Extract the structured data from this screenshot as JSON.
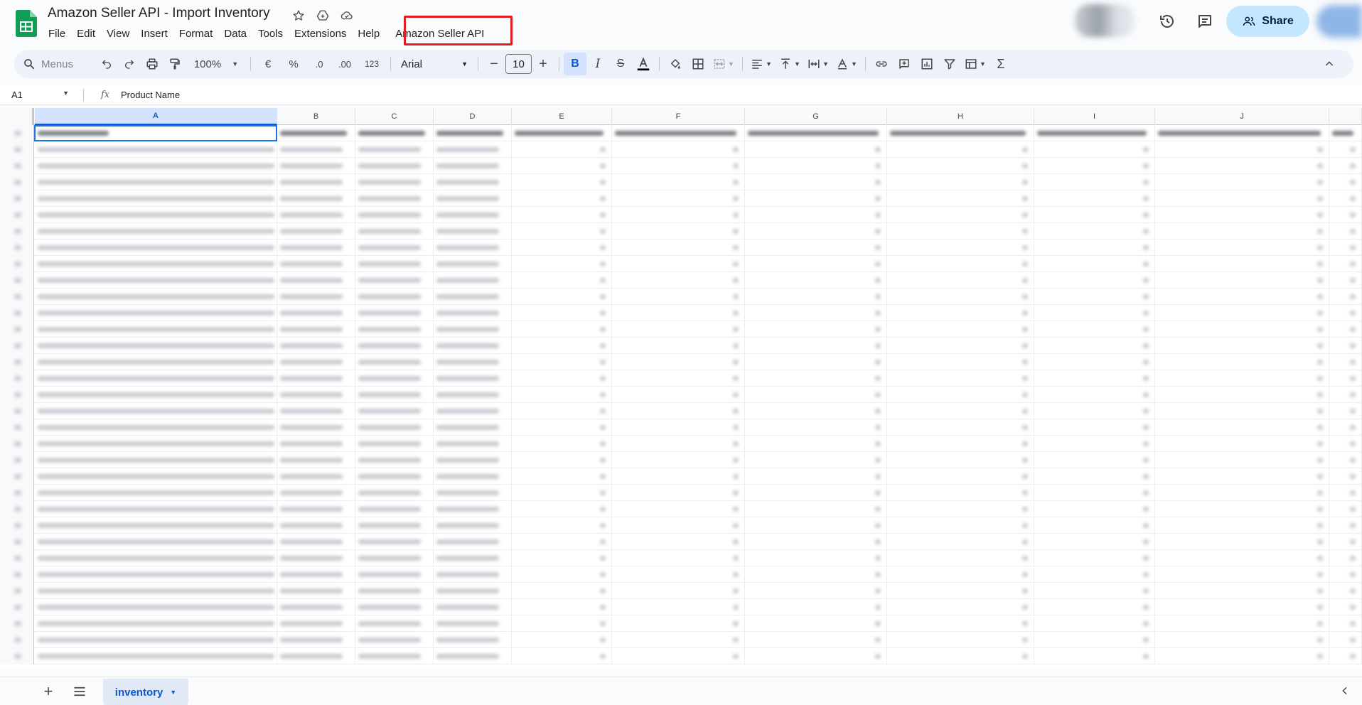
{
  "doc": {
    "title": "Amazon Seller API - Import Inventory"
  },
  "menu": {
    "items": [
      "File",
      "Edit",
      "View",
      "Insert",
      "Format",
      "Data",
      "Tools",
      "Extensions",
      "Help",
      "Amazon Seller API"
    ]
  },
  "header": {
    "share_label": "Share"
  },
  "toolbar": {
    "search_placeholder": "Menus",
    "zoom": "100%",
    "currency": "€",
    "percent": "%",
    "decrease_decimal": ".0",
    "increase_decimal": ".00",
    "number_format": "123",
    "font": "Arial",
    "font_size": "10",
    "bold": "B"
  },
  "formula_bar": {
    "cell_ref": "A1",
    "value": "Product Name"
  },
  "grid": {
    "columns": [
      "A",
      "B",
      "C",
      "D",
      "E",
      "F",
      "G",
      "H",
      "I",
      "J"
    ],
    "selected_column": "A",
    "selected_cell_value": "Product Name",
    "row_count_visible": 33,
    "content_note": "cell contents blurred"
  },
  "sheets": {
    "active_tab": "inventory"
  },
  "colors": {
    "accent": "#0b57d0",
    "share_bg": "#c2e7ff",
    "highlight_box": "#e31b23",
    "sheets_green": "#0f9d58"
  }
}
